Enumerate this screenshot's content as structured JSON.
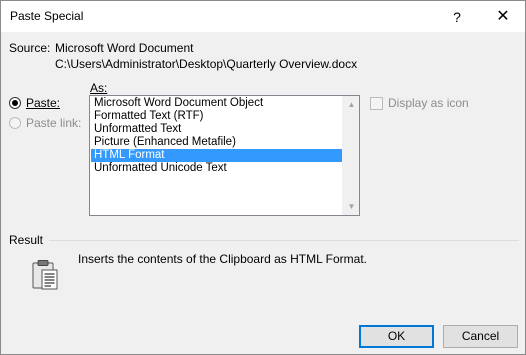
{
  "window": {
    "title": "Paste Special",
    "help_glyph": "?",
    "close_glyph": "✕"
  },
  "source": {
    "label": "Source:",
    "value": "Microsoft Word Document",
    "path": "C:\\Users\\Administrator\\Desktop\\Quarterly Overview.docx"
  },
  "as": {
    "label": "As:"
  },
  "paste_options": [
    {
      "label": "Paste:",
      "checked": true,
      "disabled": false
    },
    {
      "label": "Paste link:",
      "checked": false,
      "disabled": true
    }
  ],
  "list": {
    "items": [
      "Microsoft Word Document Object",
      "Formatted Text (RTF)",
      "Unformatted Text",
      "Picture (Enhanced Metafile)",
      "HTML Format",
      "Unformatted Unicode Text"
    ],
    "selected_index": 4,
    "scroll_up_glyph": "▲",
    "scroll_down_glyph": "▼"
  },
  "display_as_icon": {
    "label": "Display as icon",
    "checked": false,
    "disabled": true
  },
  "result": {
    "label": "Result",
    "text": "Inserts the contents of the Clipboard as HTML Format."
  },
  "buttons": {
    "ok": "OK",
    "cancel": "Cancel"
  },
  "colors": {
    "selection": "#3399ff",
    "default_button_border": "#0078d7"
  }
}
